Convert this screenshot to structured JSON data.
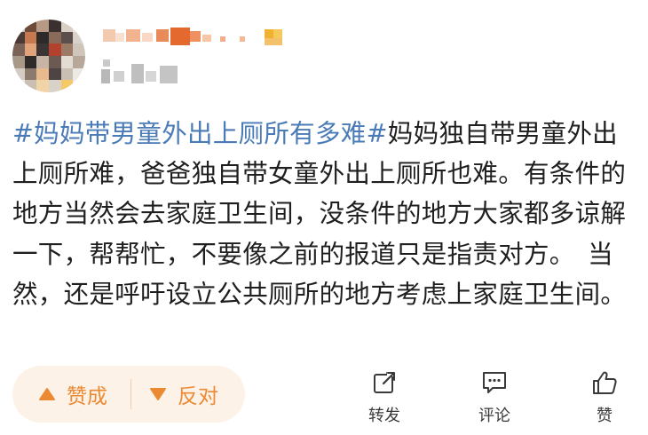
{
  "post": {
    "hashtag": "#妈妈带男童外出上厕所有多难#",
    "body": "妈妈独自带男童外出上厕所难，爸爸独自带女童外出上厕所也难。有条件的地方当然会去家庭卫生间，没条件的地方大家都多谅解一下，帮帮忙，不要像之前的报道只是指责对方。　当然，还是呼吁设立公共厕所的地方考虑上家庭卫生间。"
  },
  "vote": {
    "up_label": "赞成",
    "down_label": "反对"
  },
  "actions": {
    "repost_label": "转发",
    "comment_label": "评论",
    "like_label": "赞"
  },
  "colors": {
    "hashtag": "#4a7bb7",
    "vote_accent": "#ec8a33",
    "vote_bg": "#fdf2e7"
  },
  "icons": {
    "up": "triangle-up-icon",
    "down": "triangle-down-icon",
    "repost": "share-icon",
    "comment": "comment-icon",
    "like": "thumbs-up-icon"
  }
}
